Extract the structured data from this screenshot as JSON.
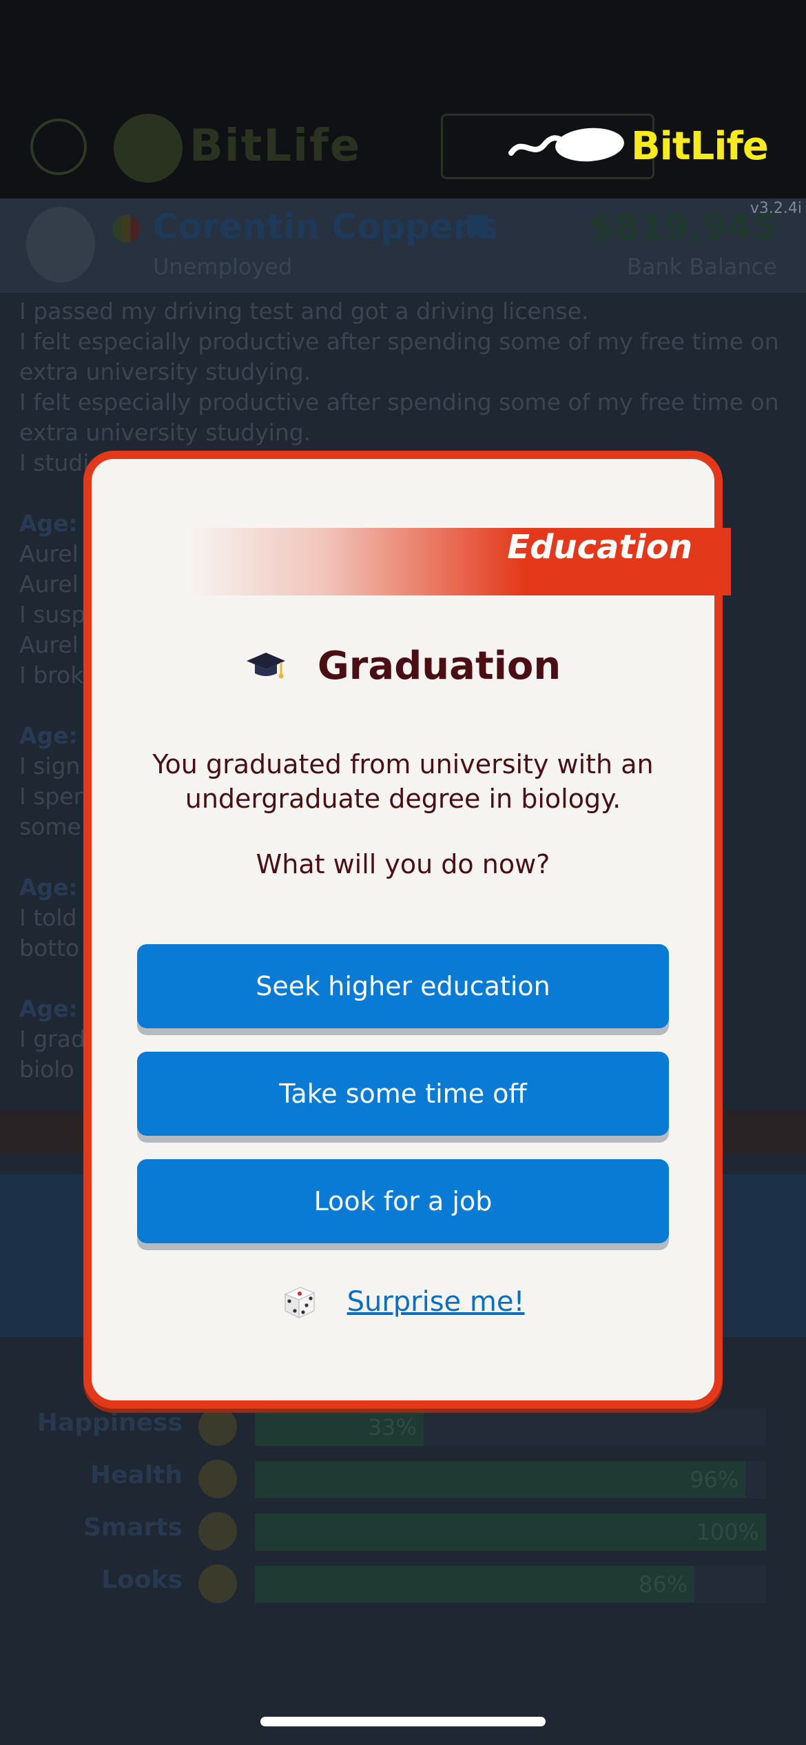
{
  "app": {
    "brand": "BitLife",
    "version": "v3.2.4i"
  },
  "character": {
    "name": "Corentin Coppens",
    "occupation": "Unemployed",
    "balance": "$819,945",
    "balance_label": "Bank Balance"
  },
  "log": [
    {
      "type": "line",
      "text": "I passed my driving test and got a driving license."
    },
    {
      "type": "line",
      "text": "I felt especially productive after spending some of my free time on extra university studying."
    },
    {
      "type": "line",
      "text": "I felt especially productive after spending some of my free time on extra university studying."
    },
    {
      "type": "line",
      "text": "I studi"
    },
    {
      "type": "age",
      "text": "Age:"
    },
    {
      "type": "line",
      "text": "Aurel"
    },
    {
      "type": "line",
      "text": "Aurel"
    },
    {
      "type": "line",
      "text": "I susp"
    },
    {
      "type": "line",
      "text": "Aurel"
    },
    {
      "type": "line",
      "text": "I brok"
    },
    {
      "type": "age",
      "text": "Age:"
    },
    {
      "type": "line",
      "text": "I sign"
    },
    {
      "type": "line",
      "text": "I spen"
    },
    {
      "type": "line",
      "text": "some"
    },
    {
      "type": "age",
      "text": "Age:"
    },
    {
      "type": "line",
      "text": "I told                                                                                  one"
    },
    {
      "type": "line",
      "text": "botto"
    },
    {
      "type": "age",
      "text": "Age:"
    },
    {
      "type": "line",
      "text": "I grad"
    },
    {
      "type": "line",
      "text": "biolo"
    }
  ],
  "stats": [
    {
      "label": "Happiness",
      "value": "33%",
      "fraction": 0.33
    },
    {
      "label": "Health",
      "value": "96%",
      "fraction": 0.96
    },
    {
      "label": "Smarts",
      "value": "100%",
      "fraction": 1.0
    },
    {
      "label": "Looks",
      "value": "86%",
      "fraction": 0.86
    }
  ],
  "modal": {
    "category": "Education",
    "title": "Graduation",
    "description": "You graduated from university with an undergraduate degree in biology.",
    "question": "What will you do now?",
    "choices": [
      "Seek higher education",
      "Take some time off",
      "Look for a job"
    ],
    "surprise_label": "Surprise me!"
  },
  "colors": {
    "modal_border": "#e3391a",
    "button_blue": "#0a7bd4",
    "title_text": "#4a0f14",
    "brand_yellow": "#f7ea1e"
  },
  "icons": {
    "title_icon": "graduation-cap-icon",
    "surprise_icon": "dice-icon"
  }
}
